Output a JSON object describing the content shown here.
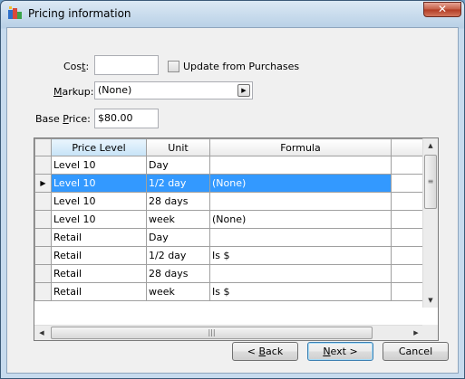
{
  "window": {
    "title": "Pricing information",
    "close_label": "✕"
  },
  "form": {
    "cost_label_prefix": "Cos",
    "cost_label_underlined": "t",
    "cost_label_suffix": ":",
    "cost_value": "",
    "update_checkbox_label": "Update from Purchases",
    "update_checked": false,
    "markup_label_underlined": "M",
    "markup_label_rest": "arkup:",
    "markup_value": "(None)",
    "base_price_label_prefix": "Base ",
    "base_price_label_underlined": "P",
    "base_price_label_suffix": "rice:",
    "base_price_value": "$80.00"
  },
  "grid": {
    "columns": [
      "Price Level",
      "Unit",
      "Formula",
      ""
    ],
    "sorted_column": "Price Level",
    "rows": [
      {
        "level": "Level 10",
        "unit": "Day",
        "formula": "",
        "selected": false
      },
      {
        "level": "Level 10",
        "unit": "1/2 day",
        "formula": "(None)",
        "selected": true
      },
      {
        "level": "Level 10",
        "unit": "28 days",
        "formula": "",
        "selected": false
      },
      {
        "level": "Level 10",
        "unit": "week",
        "formula": "(None)",
        "selected": false
      },
      {
        "level": "Retail",
        "unit": "Day",
        "formula": "",
        "selected": false
      },
      {
        "level": "Retail",
        "unit": "1/2 day",
        "formula": "Is $",
        "selected": false
      },
      {
        "level": "Retail",
        "unit": "28 days",
        "formula": "",
        "selected": false
      },
      {
        "level": "Retail",
        "unit": "week",
        "formula": "Is $",
        "selected": false
      }
    ]
  },
  "buttons": {
    "back_prefix": "< ",
    "back_underlined": "B",
    "back_rest": "ack",
    "next_underlined": "N",
    "next_rest": "ext >",
    "cancel": "Cancel"
  },
  "icons": {
    "app": "pricing-app-icon",
    "row_indicator": "row-pointer-icon"
  }
}
